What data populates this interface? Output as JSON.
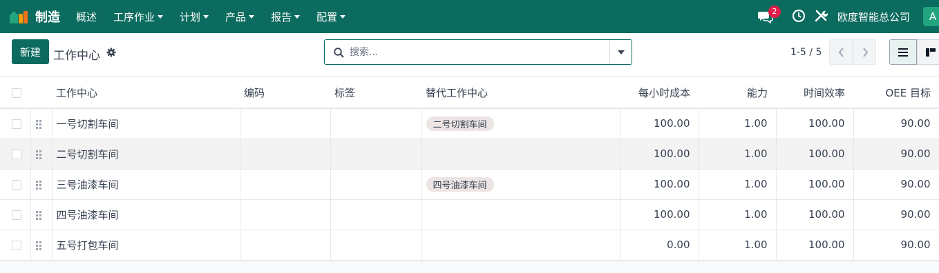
{
  "navbar": {
    "app_name": "制造",
    "menu": [
      {
        "label": "概述",
        "has_caret": false
      },
      {
        "label": "工序作业",
        "has_caret": true
      },
      {
        "label": "计划",
        "has_caret": true
      },
      {
        "label": "产品",
        "has_caret": true
      },
      {
        "label": "报告",
        "has_caret": true
      },
      {
        "label": "配置",
        "has_caret": true
      }
    ],
    "message_count": "2",
    "company": "欧度智能总公司",
    "avatar_letter": "A",
    "colors": {
      "brand": "#0b6b5e",
      "badge": "#e11d48",
      "avatar": "#21a57e"
    }
  },
  "control": {
    "new_label": "新建",
    "title": "工作中心",
    "search_placeholder": "搜索...",
    "pager": "1-5 / 5"
  },
  "table": {
    "columns": [
      "工作中心",
      "编码",
      "标签",
      "替代工作中心",
      "每小时成本",
      "能力",
      "时间效率",
      "OEE 目标"
    ],
    "rows": [
      {
        "name": "一号切割车间",
        "code": "",
        "tags": "",
        "alt": "二号切割车间",
        "cost": "100.00",
        "capacity": "1.00",
        "efficiency": "100.00",
        "oee": "90.00"
      },
      {
        "name": "二号切割车间",
        "code": "",
        "tags": "",
        "alt": "",
        "cost": "100.00",
        "capacity": "1.00",
        "efficiency": "100.00",
        "oee": "90.00"
      },
      {
        "name": "三号油漆车间",
        "code": "",
        "tags": "",
        "alt": "四号油漆车间",
        "cost": "100.00",
        "capacity": "1.00",
        "efficiency": "100.00",
        "oee": "90.00"
      },
      {
        "name": "四号油漆车间",
        "code": "",
        "tags": "",
        "alt": "",
        "cost": "100.00",
        "capacity": "1.00",
        "efficiency": "100.00",
        "oee": "90.00"
      },
      {
        "name": "五号打包车间",
        "code": "",
        "tags": "",
        "alt": "",
        "cost": "0.00",
        "capacity": "1.00",
        "efficiency": "100.00",
        "oee": "90.00"
      }
    ]
  }
}
